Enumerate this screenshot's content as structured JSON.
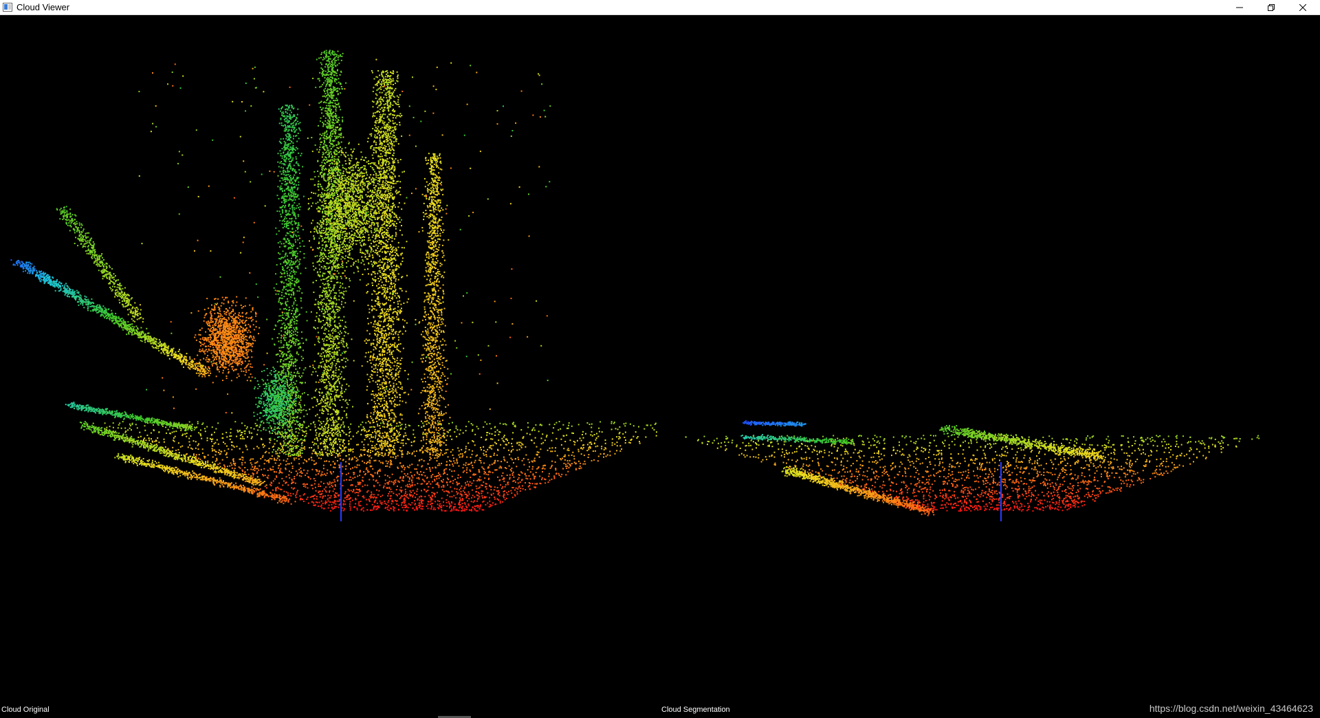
{
  "window": {
    "title": "Cloud Viewer",
    "controls": {
      "minimize": "minimize-icon",
      "restore": "restore-icon",
      "close": "close-icon"
    }
  },
  "viewports": {
    "left": {
      "label": "Cloud Original",
      "background": "#000000"
    },
    "right": {
      "label": "Cloud Segmentation",
      "background": "#000000"
    }
  },
  "watermark": "https://blog.csdn.net/weixin_43464623",
  "colors": {
    "red": "#ff1a1a",
    "orange": "#ff8c1a",
    "yellow": "#e8e81a",
    "green": "#33cc33",
    "cyan": "#1ad4e8",
    "blue": "#1a3aff"
  }
}
